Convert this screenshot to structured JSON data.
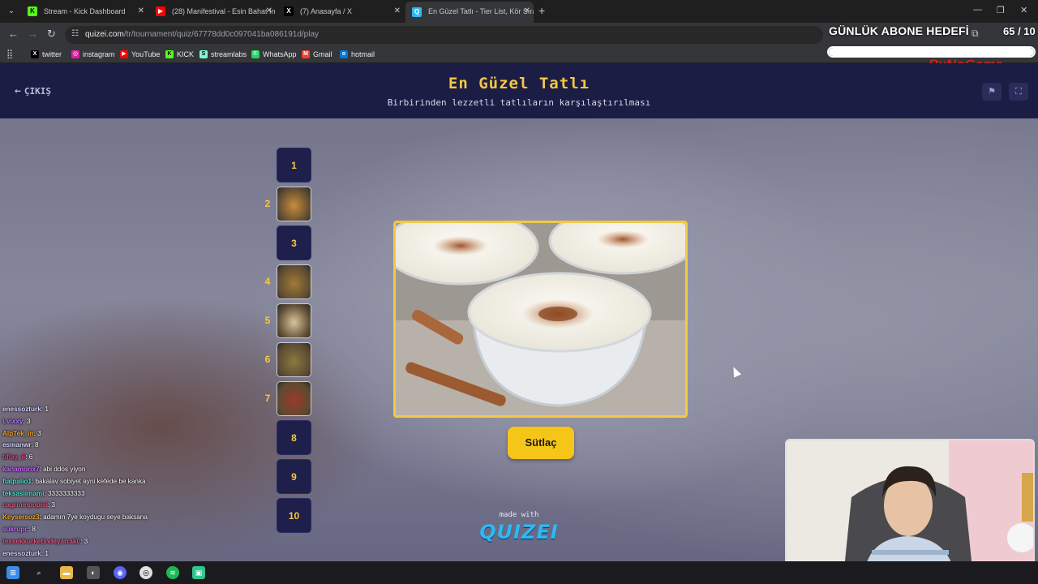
{
  "browser": {
    "tabs": [
      {
        "title": "Stream - Kick Dashboard",
        "icon": "kick-icon"
      },
      {
        "title": "(28) Manifestival - Esin Bahat In",
        "icon": "youtube-icon"
      },
      {
        "title": "(7) Anasayfa / X",
        "icon": "x-icon"
      },
      {
        "title": "En Güzel Tatlı - Tier List, Kör Sıra",
        "icon": "quizei-icon"
      }
    ],
    "url_host": "quizei.com",
    "url_path": "/tr/tournament/quiz/67778dd0c097041ba086191d/play",
    "bookmarks": [
      "twitter",
      "instagram",
      "YouTube",
      "KICK",
      "streamlabs",
      "WhatsApp",
      "Gmail",
      "hotmail"
    ]
  },
  "overlay": {
    "goal_title": "GÜNLÜK ABONE HEDEFİ",
    "goal_count": "65 / 10",
    "goal_progress": 1.0,
    "brand": "ByNoGame"
  },
  "quiz": {
    "back_label": "ÇIKIŞ",
    "title": "En Güzel Tatlı",
    "subtitle": "Birbirinden lezzetli tatlıların karşılaştırılması",
    "slots": [
      {
        "num": "1",
        "filled": false,
        "label": "1"
      },
      {
        "num": "2",
        "filled": true,
        "label": ""
      },
      {
        "num": "3",
        "filled": false,
        "label": "3"
      },
      {
        "num": "4",
        "filled": true,
        "label": ""
      },
      {
        "num": "5",
        "filled": true,
        "label": ""
      },
      {
        "num": "6",
        "filled": true,
        "label": ""
      },
      {
        "num": "7",
        "filled": true,
        "label": ""
      },
      {
        "num": "8",
        "filled": false,
        "label": "8"
      },
      {
        "num": "9",
        "filled": false,
        "label": "9"
      },
      {
        "num": "10",
        "filled": false,
        "label": "10"
      }
    ],
    "current_item": "Sütlaç",
    "made_with": "made with",
    "brand": "QUIZEI"
  },
  "chat": [
    {
      "user": "enessozturk",
      "msg": ": 1",
      "color": "#d8d8ff"
    },
    {
      "user": "Lvixxy",
      "msg": ": 3",
      "color": "#b57cff"
    },
    {
      "user": "AlpTek_in",
      "msg": ": 3",
      "color": "#f5a623"
    },
    {
      "user": "esmanwr",
      "msg": ": 8",
      "color": "#d8d8ff"
    },
    {
      "user": "tiflay_6",
      "msg": ": 6",
      "color": "#e83e8c"
    },
    {
      "user": "kanamorix7",
      "msg": ": abi ddos yiyon",
      "color": "#c86bfa"
    },
    {
      "user": "fiatpalio1",
      "msg": ": bakalav sobiyet ayni kefede be kanka",
      "color": "#4ce0d2"
    },
    {
      "user": "teksaslimami",
      "msg": ": 3333333333",
      "color": "#4ce0d2"
    },
    {
      "user": "cagrininpopisi",
      "msg": ": 3",
      "color": "#e75480"
    },
    {
      "user": "Keysersoz3",
      "msg": ": adamın 7ye koydugu seye baksana",
      "color": "#f5a623"
    },
    {
      "user": "sukrupc",
      "msg": ": 8",
      "color": "#c86bfa"
    },
    {
      "user": "tessekkurketindeyarrak0",
      "msg": ": 3",
      "color": "#e75480"
    },
    {
      "user": "enessozturk",
      "msg": ": 1",
      "color": "#d8d8ff"
    },
    {
      "user": "ogiy1",
      "msg": ": midye 1",
      "color": "#ffffff"
    }
  ]
}
